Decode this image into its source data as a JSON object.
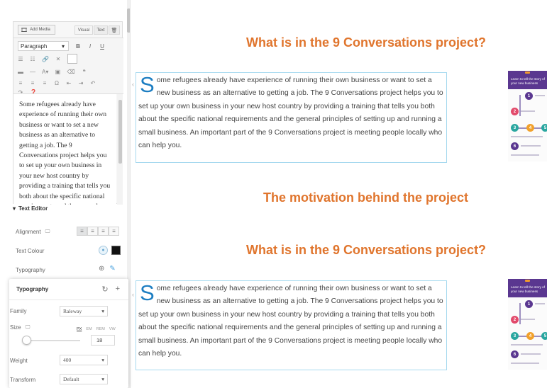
{
  "editor": {
    "add_media_label": "Add Media",
    "tabs": [
      "Visual",
      "Text"
    ],
    "collapse_glyph": "🗑",
    "format_select": "Paragraph",
    "content": "Some refugees already have experience of running their own business or want to set a new business as an alternative to getting a job. The 9 Conversations project helps you to set up your own business in your new host country by providing a training that tells you both about the specific national requirements and the general principles of setting up and running a small business."
  },
  "section": {
    "title": "Text Editor"
  },
  "controls": {
    "alignment_label": "Alignment",
    "text_colour_label": "Text Colour",
    "text_colour_value": "#111111",
    "typography_label": "Typography"
  },
  "typography_popover": {
    "title": "Typography",
    "family_label": "Family",
    "family_value": "Raleway",
    "size_label": "Size",
    "size_units": [
      "PX",
      "EM",
      "REM",
      "VW"
    ],
    "size_unit_selected": "PX",
    "size_value": "18",
    "weight_label": "Weight",
    "weight_value": "400",
    "transform_label": "Transform",
    "transform_value": "Default"
  },
  "preview": {
    "heading_1": "What is in the 9 Conversations project?",
    "heading_2": "The motivation behind the project",
    "heading_3": "What is in the 9 Conversations project?",
    "dropcap": "S",
    "paragraph_rest": "ome refugees already have experience of running their own business or want to set a new business as an alternative to getting a job. The 9 Conversations project helps you to set up your own business in your new host country by providing a training that tells you both about the specific national requirements and the general principles of setting up and running a small business. An important part of the 9 Conversations project is meeting people locally who can help you.",
    "infographic_title": "Learn to tell the story of your new business",
    "heading_color": "#e0752d",
    "dropcap_color": "#1d7ec2"
  }
}
